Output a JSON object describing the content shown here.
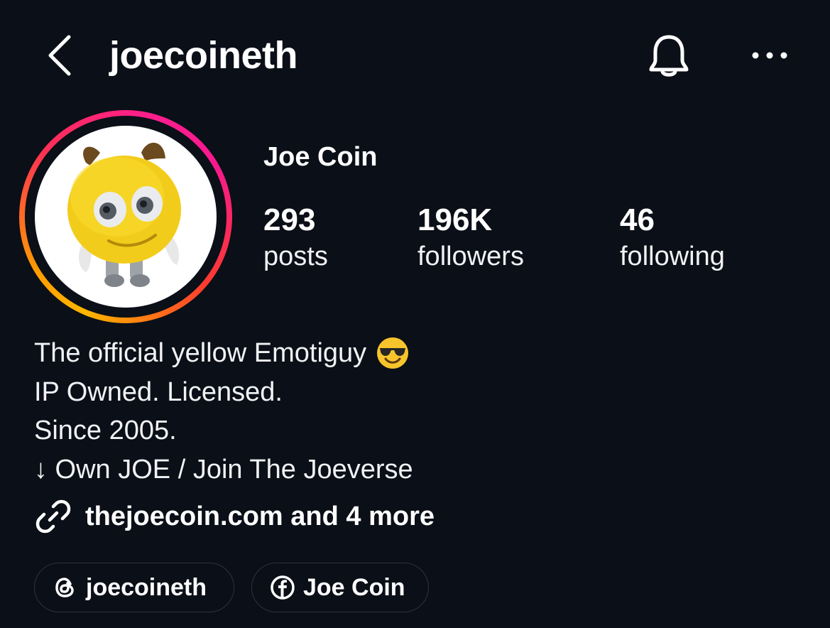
{
  "header": {
    "username": "joecoineth",
    "icons": {
      "back": "chevron-left-icon",
      "notifications": "bell-icon",
      "more": "more-horizontal-icon"
    }
  },
  "profile": {
    "display_name": "Joe Coin",
    "avatar": {
      "description_icon": "yellow-emoticon-character-avatar",
      "ring_colors": [
        "#ffb800",
        "#ff2e55",
        "#f7198f"
      ]
    }
  },
  "stats": [
    {
      "count": "293",
      "label": "posts"
    },
    {
      "count": "196K",
      "label": "followers"
    },
    {
      "count": "46",
      "label": "following"
    }
  ],
  "bio": {
    "lines": [
      "The official yellow Emotiguy",
      "IP Owned. Licensed.",
      "Since 2005.",
      "↓ Own JOE / Join The Joeverse"
    ],
    "line1_emoji": "smiling-face-with-sunglasses-emoji"
  },
  "links": {
    "icon": "link-icon",
    "text": "thejoecoin.com and 4 more"
  },
  "social_pills": [
    {
      "icon": "threads-icon",
      "label": "joecoineth"
    },
    {
      "icon": "facebook-icon",
      "label": "Joe Coin"
    }
  ],
  "colors": {
    "background": "#0b0f17",
    "text": "#ffffff",
    "pill_border": "#2e333c"
  }
}
